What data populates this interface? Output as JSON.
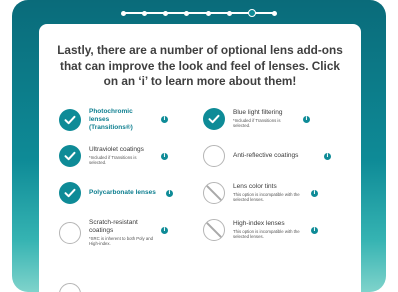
{
  "intro_text": "Lastly, there are a number of optional lens add-ons that can improve the look and feel of lenses. Click on an ‘i’ to learn more about them!",
  "progress": {
    "steps": 8,
    "current": 7
  },
  "info_glyph": "i",
  "colors": {
    "accent": "#0e8b97",
    "frame_top": "#0a6b7a",
    "frame_bottom": "#7fd3cb"
  },
  "options": [
    {
      "label": "Photochromic lenses (Transitions®)",
      "note": "",
      "state": "checked"
    },
    {
      "label": "Blue light filtering",
      "note": "*Included if Transitions is selected.",
      "state": "checked"
    },
    {
      "label": "Ultraviolet coatings",
      "note": "*Included if Transitions is selected.",
      "state": "checked"
    },
    {
      "label": "Anti-reflective coatings",
      "note": "",
      "state": "empty"
    },
    {
      "label": "Polycarbonate lenses",
      "note": "",
      "state": "checked"
    },
    {
      "label": "Lens color tints",
      "note": "This option is incompatible with the selected lenses.",
      "state": "disabled"
    },
    {
      "label": "Scratch-resistant coatings",
      "note": "*SRC is inherent to both Poly and High-index.",
      "state": "empty"
    },
    {
      "label": "High-index lenses",
      "note": "This option is incompatible with the selected lenses.",
      "state": "disabled"
    }
  ]
}
